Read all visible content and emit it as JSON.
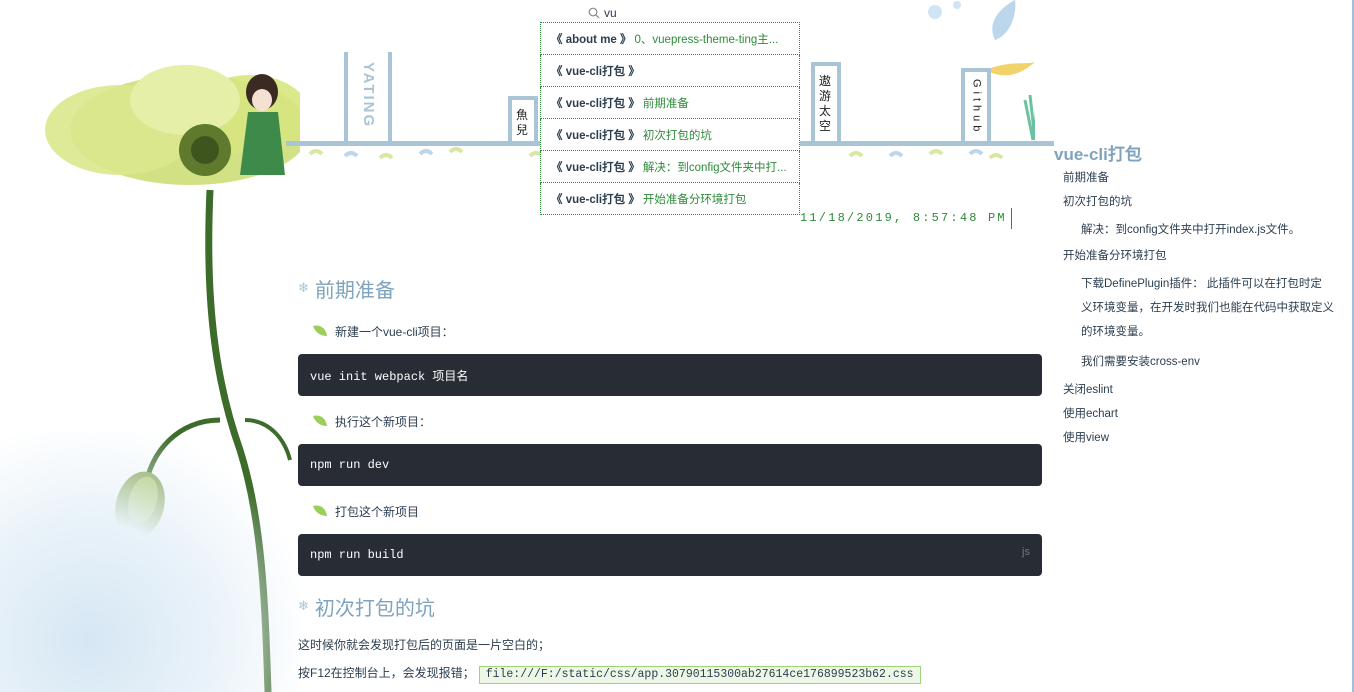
{
  "search": {
    "value": "vu",
    "placeholder": ""
  },
  "suggestions": [
    {
      "page": "《 about me 》",
      "header": "0、vuepress-theme-ting主..."
    },
    {
      "page": "《 vue-cli打包 》",
      "header": ""
    },
    {
      "page": "《 vue-cli打包 》",
      "header": "前期准备"
    },
    {
      "page": "《 vue-cli打包 》",
      "header": "初次打包的坑"
    },
    {
      "page": "《 vue-cli打包 》",
      "header": "解决：到config文件夹中打..."
    },
    {
      "page": "《 vue-cli打包 》",
      "header": "开始准备分环境打包"
    }
  ],
  "nav": {
    "logo": "YATING",
    "yuer_line1": "魚",
    "yuer_line2": "兒",
    "aoyou": [
      "遨",
      "游",
      "太",
      "空"
    ],
    "github": "Github"
  },
  "datetime": "11/18/2019, 8:57:48 PM",
  "content": {
    "h2_prep": "前期准备",
    "step1": "新建一个vue-cli项目：",
    "code1": "vue init webpack 项目名",
    "step2": "执行这个新项目：",
    "code2": "npm run dev",
    "step3": "打包这个新项目",
    "code3": "npm run build",
    "code3_lang": "js",
    "h2_pit": "初次打包的坑",
    "para1": "这时候你就会发现打包后的页面是一片空白的；",
    "para2": "按F12在控制台上，会发现报错；",
    "inline_code": "file:///F:/static/css/app.30790115300ab27614ce176899523b62.css"
  },
  "toc": {
    "title": "vue-cli打包",
    "items": {
      "prep": "前期准备",
      "pit": "初次打包的坑",
      "fix": "解决：到config文件夹中打开index.js文件。",
      "env": "开始准备分环境打包",
      "define1": "下载DefinePlugin插件： 此插件可以在打包时定",
      "define2": "义环境变量，在开发时我们也能在代码中获取定义",
      "define3": "的环境变量。",
      "crossenv": "我们需要安装cross-env",
      "eslint": "关闭eslint",
      "echart": "使用echart",
      "view": "使用view"
    }
  },
  "colors": {
    "accent_blue": "#7fa3bd",
    "rail": "#a9c4d4",
    "green": "#2e8b3a",
    "code_bg": "#282c34"
  },
  "icons": {
    "search": "search-icon",
    "leaf": "leaf-bullet-icon",
    "snow": "snowflake-icon"
  }
}
